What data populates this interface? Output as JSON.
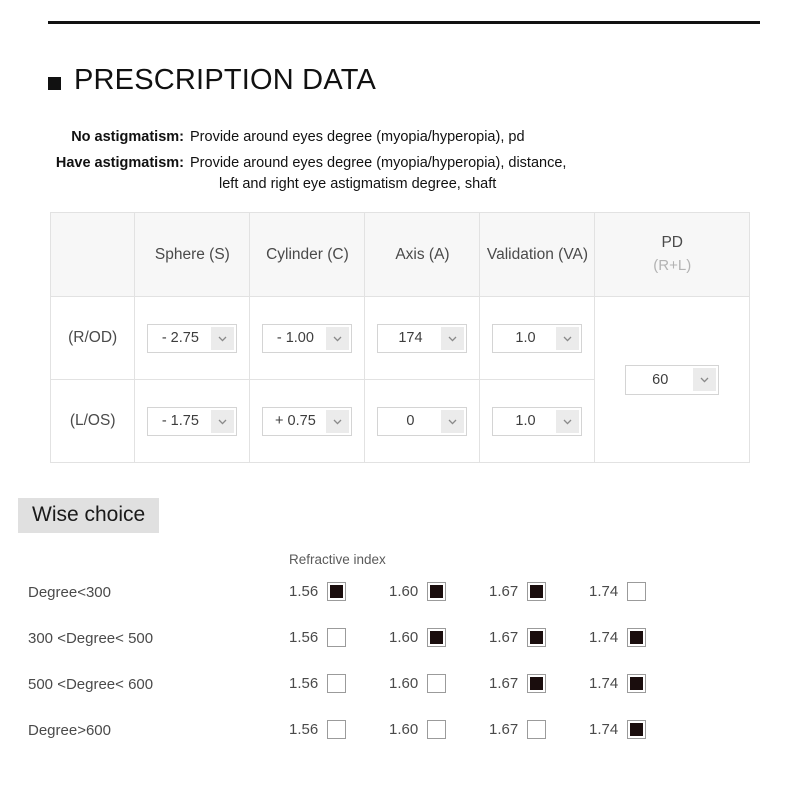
{
  "header": {
    "rule": "horizontal-rule",
    "title": "PRESCRIPTION DATA",
    "bullet": "square-bullet-icon"
  },
  "description": {
    "rows": [
      {
        "label": "No astigmatism:",
        "text": "Provide around eyes degree (myopia/hyperopia), pd",
        "continuation": ""
      },
      {
        "label": "Have astigmatism:",
        "text": "Provide around eyes degree (myopia/hyperopia), distance,",
        "continuation": "left and right eye astigmatism degree, shaft"
      }
    ]
  },
  "prescription_table": {
    "columns": {
      "eye": "",
      "sphere": "Sphere (S)",
      "cylinder": "Cylinder (C)",
      "axis": "Axis (A)",
      "validation": "Validation (VA)",
      "pd": "PD",
      "pd_sub": "(R+L)"
    },
    "rows": [
      {
        "eye": "(R/OD)",
        "sphere": "- 2.75",
        "cylinder": "- 1.00",
        "axis": "174",
        "validation": "1.0"
      },
      {
        "eye": "(L/OS)",
        "sphere": "- 1.75",
        "cylinder": "+ 0.75",
        "axis": "0",
        "validation": "1.0"
      }
    ],
    "pd_value": "60",
    "arrow_icon": "chevron-down-icon"
  },
  "wise_choice": {
    "title": "Wise choice",
    "refractive_index_label": "Refractive index",
    "index_labels": [
      "1.56",
      "1.60",
      "1.67",
      "1.74"
    ],
    "rows": [
      {
        "label": "Degree<300",
        "checked": [
          true,
          true,
          true,
          false
        ]
      },
      {
        "label": "300 <Degree< 500",
        "checked": [
          false,
          true,
          true,
          true
        ]
      },
      {
        "label": "500 <Degree< 600",
        "checked": [
          false,
          false,
          true,
          true
        ]
      },
      {
        "label": "Degree>600",
        "checked": [
          false,
          false,
          false,
          true
        ]
      }
    ]
  },
  "colors": {
    "rule": "#111111",
    "header_bg": "#f7f7f7",
    "border": "#e2e2e2",
    "text": "#4a4a4a",
    "muted": "#b3b3b3",
    "highlight_bg": "#e0e0e0",
    "checkbox_fill": "#1a0d0d"
  }
}
